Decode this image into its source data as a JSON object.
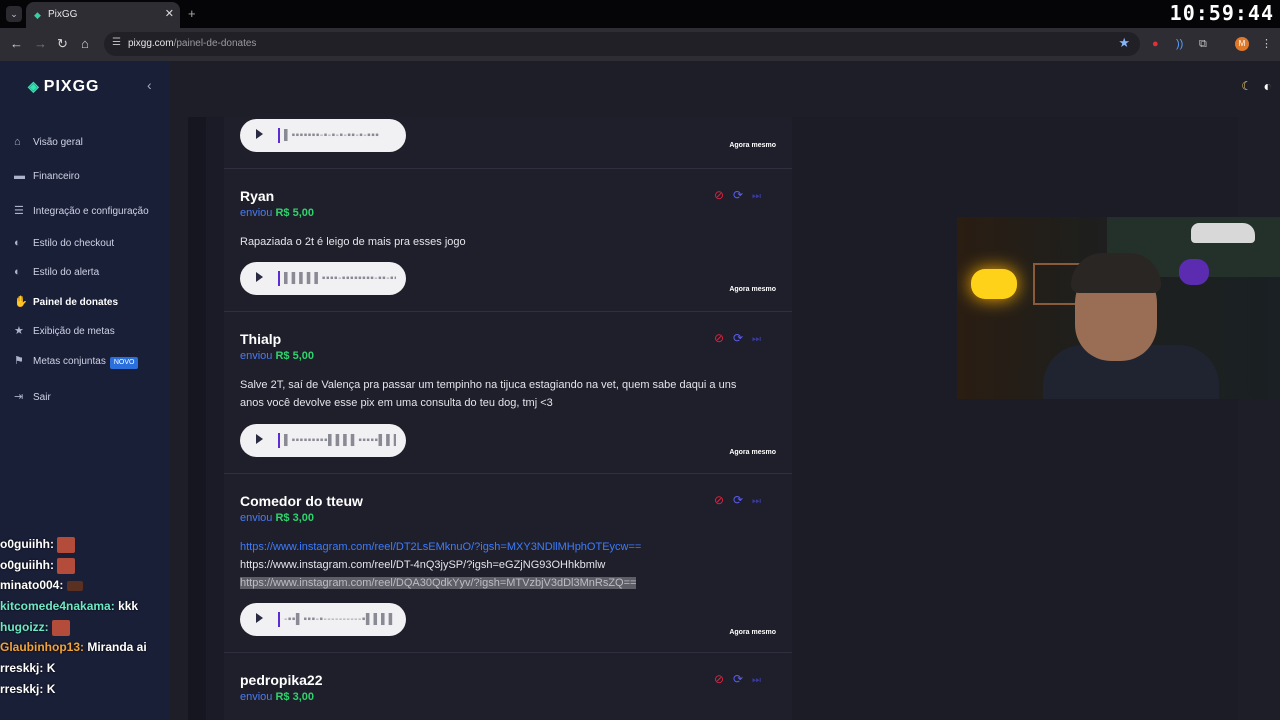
{
  "browser": {
    "tab_title": "PixGG",
    "tab_close": "✕",
    "new_tab": "+",
    "clock": "10:59:44",
    "url_host": "pixgg.com",
    "url_path": "/painel-de-donates",
    "profile_initial": "M"
  },
  "sidebar": {
    "logo": "PIXGG",
    "items": [
      {
        "label": "Visão geral",
        "icon": "home-icon"
      },
      {
        "label": "Financeiro",
        "icon": "wallet-icon"
      },
      {
        "label": "Integração e configuração",
        "icon": "document-icon"
      },
      {
        "label": "Estilo do checkout",
        "icon": "palette-icon"
      },
      {
        "label": "Estilo do alerta",
        "icon": "palette-icon"
      },
      {
        "label": "Painel de donates",
        "icon": "donate-icon"
      },
      {
        "label": "Exibição de metas",
        "icon": "star-icon"
      },
      {
        "label": "Metas conjuntas",
        "icon": "goal-icon",
        "badge": "NOVO"
      },
      {
        "label": "Sair",
        "icon": "logout-icon"
      }
    ],
    "active_item": "Painel de donates"
  },
  "chat": [
    {
      "user": "o0guiihh:",
      "color": "#ffffff",
      "text": "",
      "emote": true
    },
    {
      "user": "o0guiihh:",
      "color": "#ffffff",
      "text": "",
      "emote": true
    },
    {
      "user": "minato004:",
      "color": "#ffffff",
      "text": "",
      "emote": true
    },
    {
      "user": "kitcomede4nakama:",
      "color": "#6ee7c4",
      "text": "kkk",
      "emote": false
    },
    {
      "user": "hugoizz:",
      "color": "#6ee7c4",
      "text": "",
      "emote": true
    },
    {
      "user": "Glaubinhop13:",
      "color": "#f2a33a",
      "text": "Miranda ai",
      "emote": false
    },
    {
      "user": "rreskkj:",
      "color": "#ffffff",
      "text": "K",
      "emote": false
    },
    {
      "user": "rreskkj:",
      "color": "#ffffff",
      "text": "K",
      "emote": false
    }
  ],
  "feed": {
    "sent_verb": "enviou",
    "cards": [
      {
        "donor": "",
        "amount": "",
        "message_lines": [],
        "waveform": "▌▪▪▪▪▪▪▪-▪-▪-▪-▪▪-▪-▪▪▪",
        "time": "Agora mesmo"
      },
      {
        "donor": "Ryan",
        "amount": "R$ 5,00",
        "message_lines": [
          "Rapaziada o 2t é leigo de mais pra esses jogo"
        ],
        "waveform": "▌▌▌▌▌▪▪▪▪-▪▪▪▪▪▪▪▪-▪▪-▪▪",
        "time": "Agora mesmo"
      },
      {
        "donor": "Thialp",
        "amount": "R$ 5,00",
        "message_lines": [
          "Salve 2T, saí de Valença pra passar um tempinho na tijuca estagiando na vet, quem sabe daqui a uns",
          "anos você devolve esse pix em uma consulta do teu dog, tmj <3"
        ],
        "waveform": "▌▪▪▪▪▪▪▪▪▪▌▌▌▌▪▪▪▪▪▌▌▌▌▌",
        "time": "Agora mesmo"
      },
      {
        "donor": "Comedor do tteuw",
        "amount": "R$ 3,00",
        "links": [
          "https://www.instagram.com/reel/DT2LsEMknuO/?igsh=MXY3NDllMHphOTEycw==",
          "https://www.instagram.com/reel/DT-4nQ3jySP/?igsh=eGZjNG93OHhkbmlw",
          "https://www.instagram.com/reel/DQA30QdkYyv/?igsh=MTVzbjV3dDl3MnRsZQ=="
        ],
        "waveform": "-▪▪▌▪▪▪-▪----------▪▌▌▌▌-",
        "time": "Agora mesmo"
      },
      {
        "donor": "pedropika22",
        "amount": "R$ 3,00",
        "message_lines": [],
        "waveform": "",
        "time": ""
      }
    ]
  },
  "colors": {
    "accent_green": "#2fd36c",
    "accent_blue": "#4a7cf3",
    "block_red": "#e2233e",
    "sidebar_bg": "#1a1f38"
  }
}
